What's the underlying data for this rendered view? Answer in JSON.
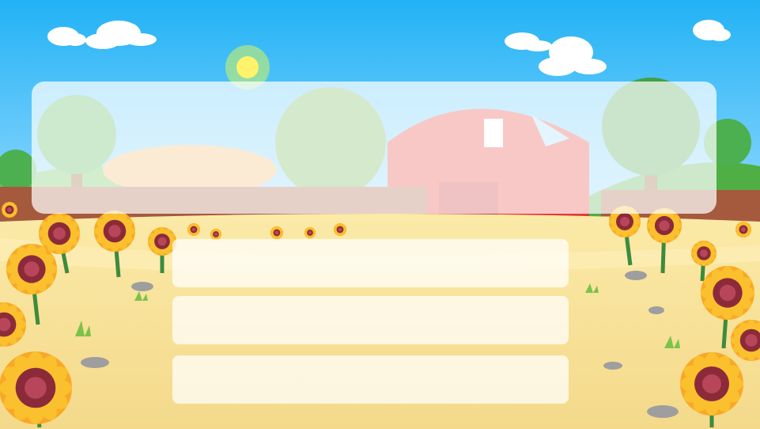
{
  "game": {
    "scene": "farm",
    "question": {
      "text": ""
    },
    "options": [
      {
        "label": ""
      },
      {
        "label": ""
      },
      {
        "label": ""
      }
    ]
  },
  "colors": {
    "sky_top": "#29b6f6",
    "sky_bottom": "#8fd9ff",
    "field": "#f7e29a",
    "barn": "#e53935",
    "grass": "#5cb848",
    "sunflower_petal": "#fbc02d",
    "sunflower_center": "#8b2b3a",
    "panel": "#ffffff"
  }
}
